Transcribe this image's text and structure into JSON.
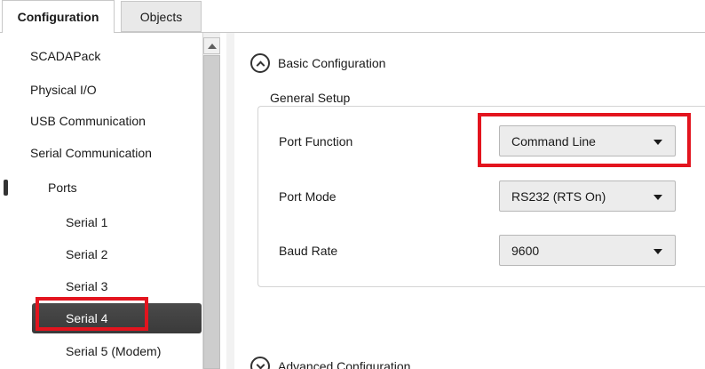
{
  "tabs": [
    {
      "label": "Configuration",
      "active": true
    },
    {
      "label": "Objects",
      "active": false
    }
  ],
  "tree": {
    "items": [
      {
        "label": "SCADAPack",
        "level": 0
      },
      {
        "label": "Physical I/O",
        "level": 0
      },
      {
        "label": "USB Communication",
        "level": 0
      },
      {
        "label": "Serial Communication",
        "level": 0
      },
      {
        "label": "Ports",
        "level": 1
      },
      {
        "label": "Serial 1",
        "level": 2
      },
      {
        "label": "Serial 2",
        "level": 2
      },
      {
        "label": "Serial 3",
        "level": 2
      },
      {
        "label": "Serial 4",
        "level": 2,
        "selected": true
      },
      {
        "label": "Serial 5 (Modem)",
        "level": 2
      }
    ]
  },
  "main": {
    "basic_section": {
      "label": "Basic Configuration",
      "icon": "collapse-up-icon"
    },
    "advanced_section": {
      "label": "Advanced Configuration",
      "icon": "expand-down-icon"
    },
    "general_setup": {
      "title": "General Setup",
      "rows": [
        {
          "label": "Port Function",
          "value": "Command Line"
        },
        {
          "label": "Port Mode",
          "value": "RS232 (RTS On)"
        },
        {
          "label": "Baud Rate",
          "value": "9600"
        }
      ]
    }
  },
  "colors": {
    "highlight": "#e3141e",
    "selection_bg": "#3f3f3f"
  }
}
